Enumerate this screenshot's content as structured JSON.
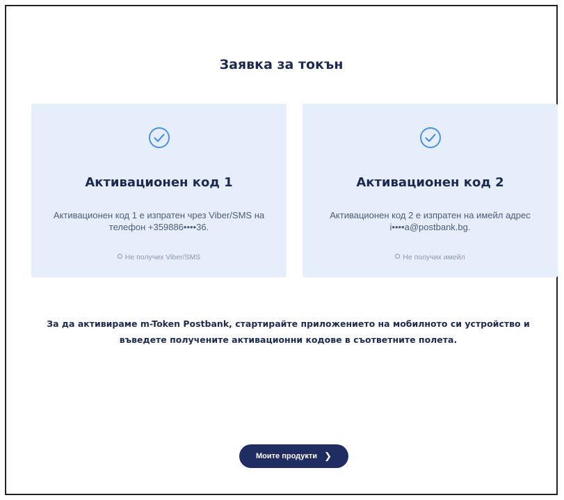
{
  "page": {
    "title": "Заявка за токън"
  },
  "cards": [
    {
      "title": "Активационен код 1",
      "description": "Активационен код 1 е изпратен чрез Viber/SMS на телефон +359886••••36.",
      "resend_link": "Не получих Viber/SMS",
      "icon": "check-circle-icon"
    },
    {
      "title": "Активационен код 2",
      "description": "Активационен код 2 е изпратен на имейл адрес i••••a@postbank.bg.",
      "resend_link": "Не получих имейл",
      "icon": "check-circle-icon"
    }
  ],
  "info_text": "За да активираме m-Token Postbank, стартирайте приложението на мобилното си устройство и въведете получените активационни кодове в съответните полета.",
  "button": {
    "label": "Моите продукти",
    "icon": "chevron-right-icon"
  },
  "colors": {
    "accent": "#4a90e2",
    "heading": "#1b2a4e",
    "card_bg": "#e6eefb",
    "button_bg": "#1f2d63"
  }
}
